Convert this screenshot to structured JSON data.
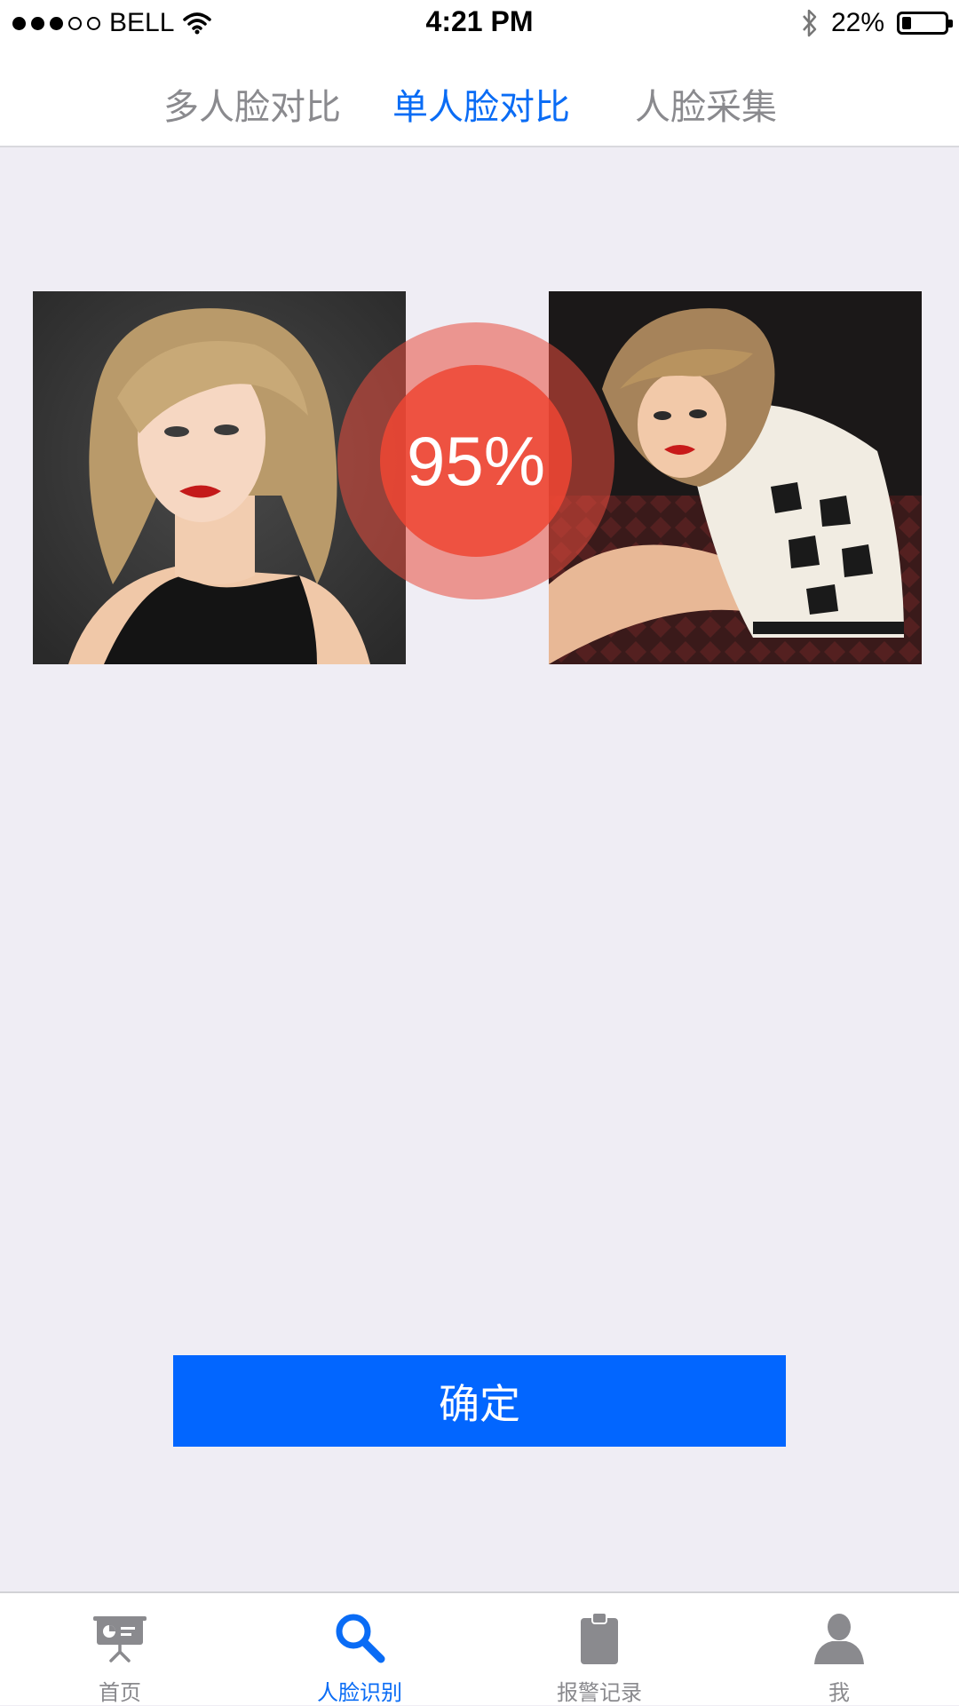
{
  "status_bar": {
    "carrier": "BELL",
    "time": "4:21 PM",
    "battery": "22%",
    "battery_level": 0.22,
    "signal_bars_filled": 3,
    "signal_bars_total": 5,
    "icons": [
      "wifi-icon",
      "bluetooth-icon",
      "battery-icon"
    ]
  },
  "top_tabs": {
    "items": [
      {
        "label": "多人脸对比",
        "active": false
      },
      {
        "label": "单人脸对比",
        "active": true
      },
      {
        "label": "人脸采集",
        "active": false
      }
    ]
  },
  "comparison": {
    "left_photo": "portrait-photo",
    "right_photo": "portrait-photo",
    "similarity": "95%"
  },
  "confirm_label": "确定",
  "bottom_tabs": {
    "items": [
      {
        "label": "首页",
        "icon": "presentation-board-icon",
        "active": false
      },
      {
        "label": "人脸识别",
        "icon": "search-icon",
        "active": true
      },
      {
        "label": "报警记录",
        "icon": "clipboard-icon",
        "active": false
      },
      {
        "label": "我",
        "icon": "user-icon",
        "active": false
      }
    ]
  },
  "colors": {
    "accent": "#0a6cf5",
    "button": "#0266ff",
    "score_circle": "#ef4634",
    "background": "#efedf4",
    "inactive": "#8a8a8e"
  }
}
